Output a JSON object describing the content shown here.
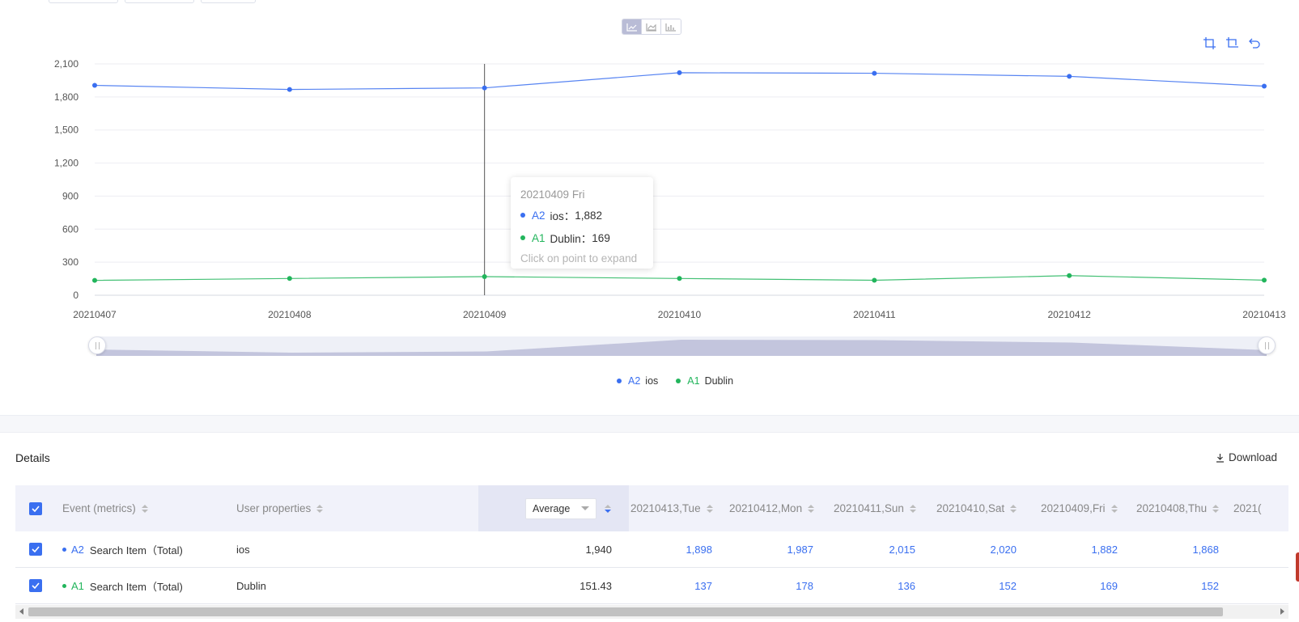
{
  "colors": {
    "series_a2": "#3a6ff0",
    "series_a1": "#22b55c",
    "accent": "#3a6ff0",
    "header_bg": "#f1f2fa",
    "zoom_fill": "#c3c5dd"
  },
  "chart_switch": {
    "options": [
      "line-chart-icon",
      "area-chart-icon",
      "bar-chart-icon"
    ],
    "active": 0
  },
  "toolbox": [
    "zoom-area-icon",
    "zoom-reset-icon",
    "restore-icon"
  ],
  "chart_data": {
    "type": "line",
    "x": [
      "20210407",
      "20210408",
      "20210409",
      "20210410",
      "20210411",
      "20210412",
      "20210413"
    ],
    "y_ticks": [
      "0",
      "300",
      "600",
      "900",
      "1,200",
      "1,500",
      "1,800",
      "2,100"
    ],
    "ylim": [
      0,
      2100
    ],
    "grid": true,
    "series": [
      {
        "name": "ios",
        "tag": "A2",
        "color": "#3a6ff0",
        "values": [
          1905,
          1868,
          1882,
          2020,
          2015,
          1987,
          1898
        ]
      },
      {
        "name": "Dublin",
        "tag": "A1",
        "color": "#22b55c",
        "values": [
          135,
          152,
          169,
          152,
          136,
          178,
          137
        ]
      }
    ],
    "hover_index": 2,
    "legend_position": "bottom-center"
  },
  "tooltip": {
    "date": "20210409 Fri",
    "rows": [
      {
        "tag": "A2",
        "label": "ios：",
        "value": "1,882",
        "color": "#3a6ff0"
      },
      {
        "tag": "A1",
        "label": "Dublin：",
        "value": "169",
        "color": "#22b55c"
      }
    ],
    "hint": "Click on point to expand"
  },
  "legend": [
    {
      "tag": "A2",
      "name": "ios",
      "color": "#3a6ff0"
    },
    {
      "tag": "A1",
      "name": "Dublin",
      "color": "#22b55c"
    }
  ],
  "details": {
    "title": "Details",
    "download_label": "Download",
    "columns": {
      "event": "Event (metrics)",
      "user_props": "User properties",
      "aggregate": "Average",
      "dates": [
        "20210413,Tue",
        "20210412,Mon",
        "20210411,Sun",
        "20210410,Sat",
        "20210409,Fri",
        "20210408,Thu",
        "2021("
      ]
    },
    "rows": [
      {
        "tag": "A2",
        "tag_color": "#3a6ff0",
        "event": "Search Item（Total)",
        "prop": "ios",
        "average": "1,940",
        "values": [
          "1,898",
          "1,987",
          "2,015",
          "2,020",
          "1,882",
          "1,868"
        ]
      },
      {
        "tag": "A1",
        "tag_color": "#22b55c",
        "event": "Search Item（Total)",
        "prop": "Dublin",
        "average": "151.43",
        "values": [
          "137",
          "178",
          "136",
          "152",
          "169",
          "152"
        ]
      }
    ]
  }
}
